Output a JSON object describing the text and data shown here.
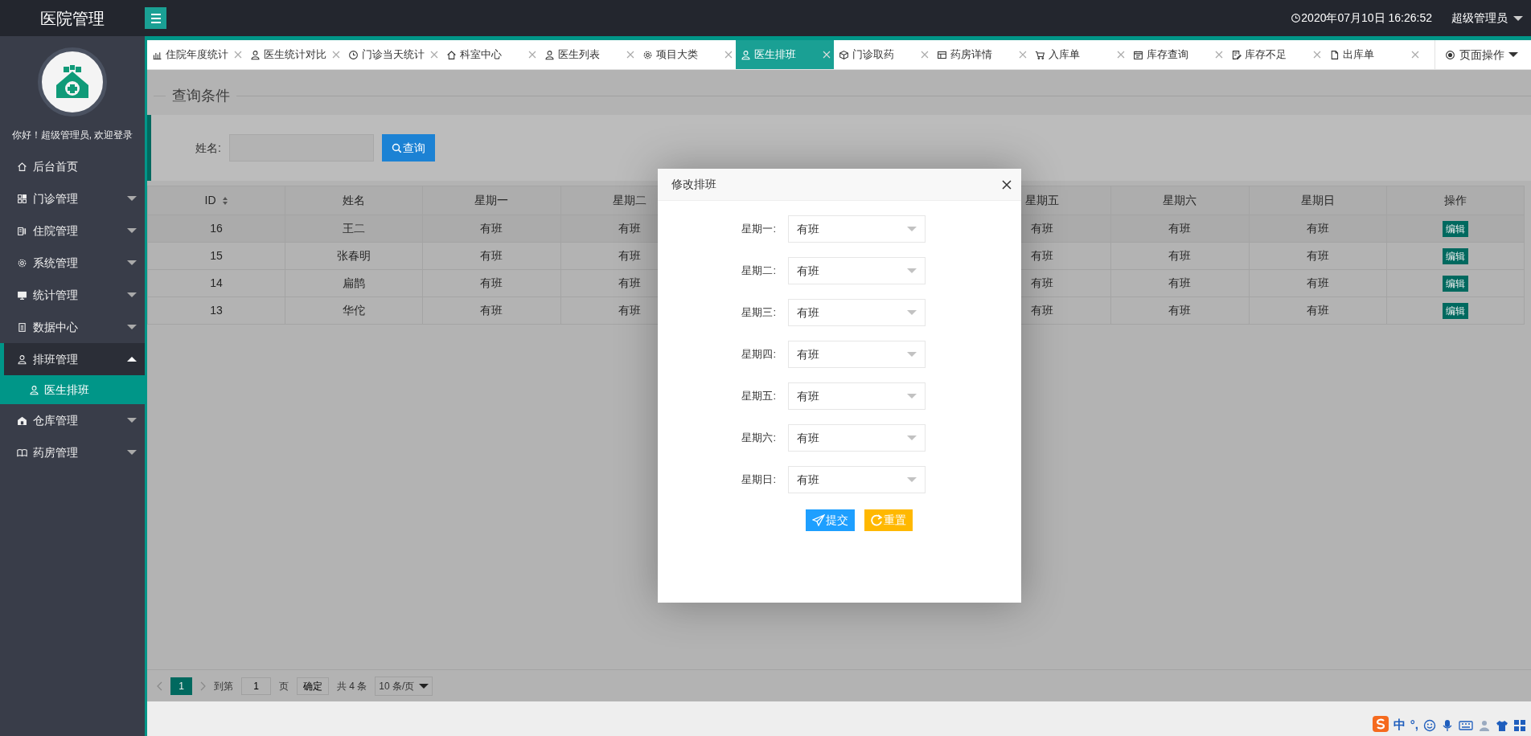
{
  "header": {
    "title": "医院管理",
    "datetime": "2020年07月10日 16:26:52",
    "user": "超级管理员"
  },
  "sidebar": {
    "welcome": "你好！超级管理员, 欢迎登录",
    "items": [
      {
        "label": "后台首页",
        "kind": "link"
      },
      {
        "label": "门诊管理",
        "kind": "group",
        "expanded": false
      },
      {
        "label": "住院管理",
        "kind": "group",
        "expanded": false
      },
      {
        "label": "系统管理",
        "kind": "group",
        "expanded": false
      },
      {
        "label": "统计管理",
        "kind": "group",
        "expanded": false
      },
      {
        "label": "数据中心",
        "kind": "group",
        "expanded": false
      },
      {
        "label": "排班管理",
        "kind": "group",
        "expanded": true,
        "children": [
          {
            "label": "医生排班",
            "selected": true
          }
        ]
      },
      {
        "label": "仓库管理",
        "kind": "group",
        "expanded": false
      },
      {
        "label": "药房管理",
        "kind": "group",
        "expanded": false
      }
    ]
  },
  "tabs": [
    {
      "label": "住院年度统计",
      "selected": false
    },
    {
      "label": "医生统计对比",
      "selected": false
    },
    {
      "label": "门诊当天统计",
      "selected": false
    },
    {
      "label": "科室中心",
      "selected": false
    },
    {
      "label": "医生列表",
      "selected": false
    },
    {
      "label": "项目大类",
      "selected": false
    },
    {
      "label": "医生排班",
      "selected": true
    },
    {
      "label": "门诊取药",
      "selected": false
    },
    {
      "label": "药房详情",
      "selected": false
    },
    {
      "label": "入库单",
      "selected": false
    },
    {
      "label": "库存查询",
      "selected": false
    },
    {
      "label": "库存不足",
      "selected": false
    },
    {
      "label": "出库单",
      "selected": false
    }
  ],
  "page_actions": "页面操作",
  "search": {
    "legend": "查询条件",
    "label": "姓名:",
    "button": "查询"
  },
  "table": {
    "columns": [
      {
        "label": "ID",
        "sortable": true
      },
      {
        "label": "姓名",
        "sortable": false
      },
      {
        "label": "星期一",
        "sortable": false
      },
      {
        "label": "星期二",
        "sortable": false
      },
      {
        "label": "星期五",
        "sortable": false
      },
      {
        "label": "星期六",
        "sortable": false
      },
      {
        "label": "星期日",
        "sortable": false
      },
      {
        "label": "操作",
        "sortable": false
      }
    ],
    "rows": [
      {
        "cells": [
          "16",
          "王二",
          "有班",
          "有班",
          "有班",
          "有班",
          "有班"
        ],
        "action": "编辑"
      },
      {
        "cells": [
          "15",
          "张春明",
          "有班",
          "有班",
          "有班",
          "有班",
          "有班"
        ],
        "action": "编辑"
      },
      {
        "cells": [
          "14",
          "扁鹊",
          "有班",
          "有班",
          "有班",
          "有班",
          "有班"
        ],
        "action": "编辑"
      },
      {
        "cells": [
          "13",
          "华佗",
          "有班",
          "有班",
          "有班",
          "有班",
          "有班"
        ],
        "action": "编辑"
      }
    ]
  },
  "pagination": {
    "pages": [
      {
        "label": "1",
        "selected": true
      }
    ],
    "goto_label": "到第",
    "goto_value": "1",
    "page_unit": "页",
    "confirm": "确定",
    "total": "共 4 条",
    "page_size": "10 条/页"
  },
  "modal": {
    "title": "修改排班",
    "fields": [
      {
        "label": "星期一:",
        "value": "有班"
      },
      {
        "label": "星期二:",
        "value": "有班"
      },
      {
        "label": "星期三:",
        "value": "有班"
      },
      {
        "label": "星期四:",
        "value": "有班"
      },
      {
        "label": "星期五:",
        "value": "有班"
      },
      {
        "label": "星期六:",
        "value": "有班"
      },
      {
        "label": "星期日:",
        "value": "有班"
      }
    ],
    "submit": "提交",
    "reset": "重置"
  },
  "tray": {
    "texts": [
      "中",
      "°,"
    ]
  }
}
